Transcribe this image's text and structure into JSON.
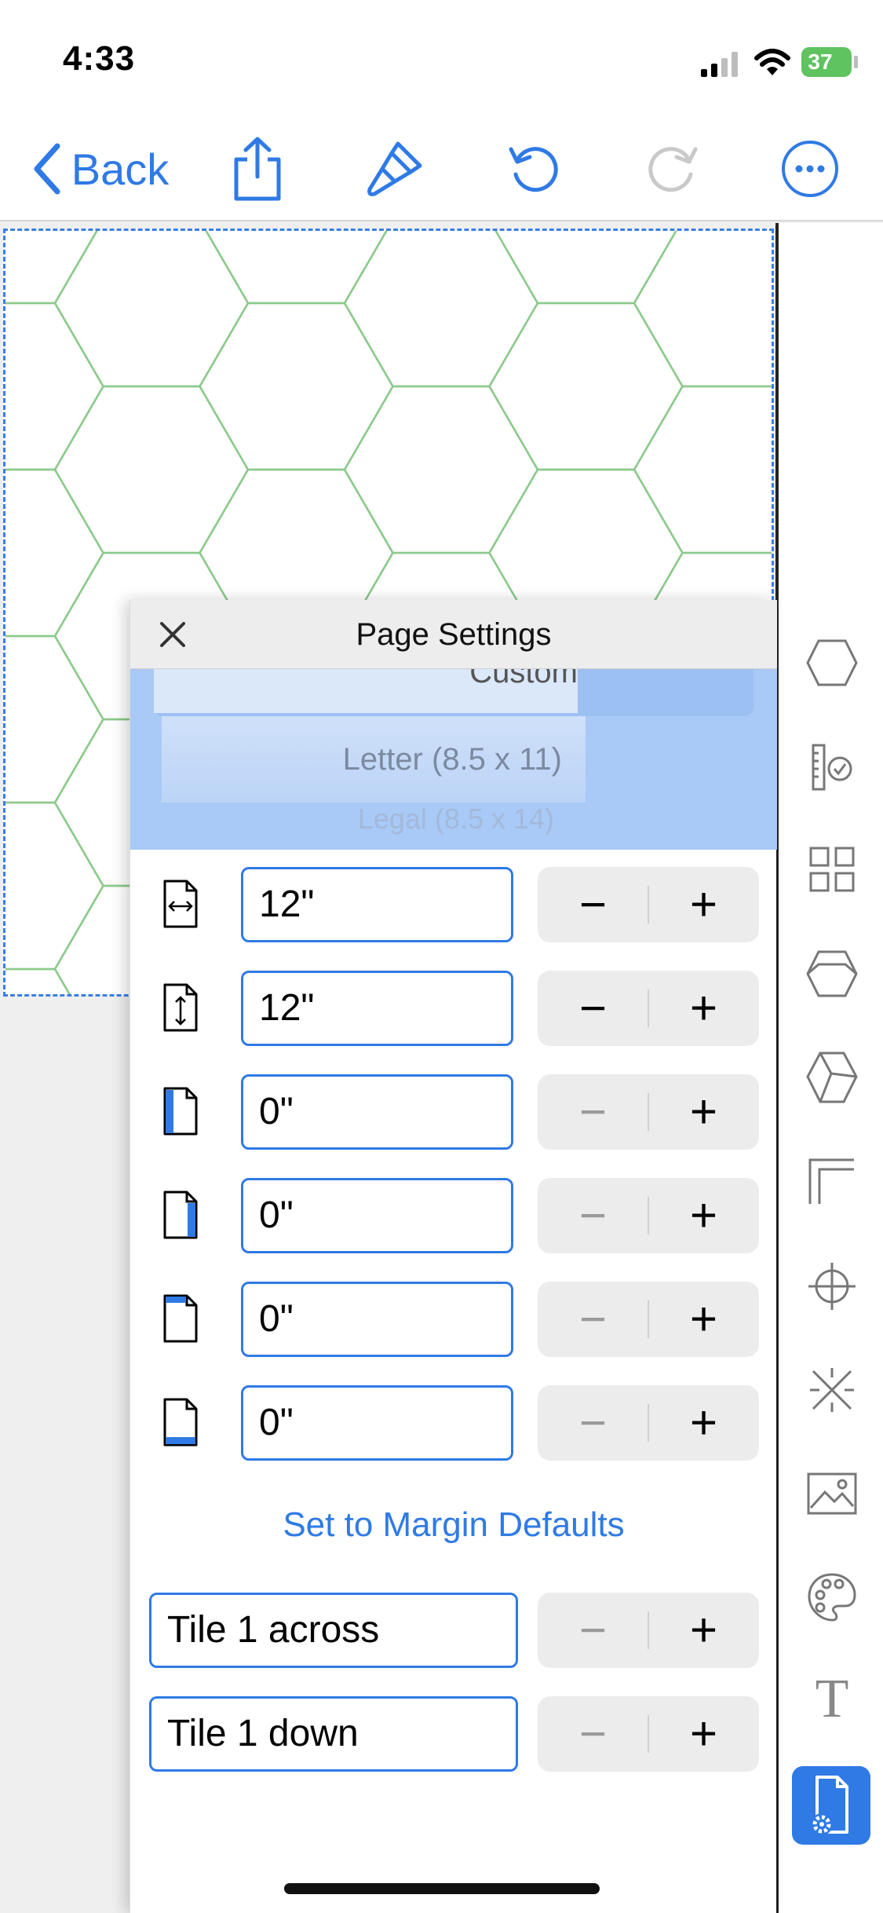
{
  "status_bar": {
    "time": "4:33",
    "battery": "37"
  },
  "toolbar": {
    "back_label": "Back",
    "icons": [
      "share-icon",
      "paintbrush-icon",
      "undo-icon",
      "redo-icon",
      "more-icon"
    ]
  },
  "panel": {
    "title": "Page Settings",
    "picker": {
      "custom": "Custom",
      "letter": "Letter (8.5 x 11)",
      "legal": "Legal (8.5 x 14)"
    },
    "rows": [
      {
        "name": "width",
        "value": "12\"",
        "minus_enabled": true
      },
      {
        "name": "height",
        "value": "12\"",
        "minus_enabled": true
      },
      {
        "name": "margin-left",
        "value": "0\"",
        "minus_enabled": false
      },
      {
        "name": "margin-right",
        "value": "0\"",
        "minus_enabled": false
      },
      {
        "name": "margin-top",
        "value": "0\"",
        "minus_enabled": false
      },
      {
        "name": "margin-bottom",
        "value": "0\"",
        "minus_enabled": false
      }
    ],
    "minus_symbol": "−",
    "plus_symbol": "+",
    "margin_defaults_label": "Set to Margin Defaults",
    "tile_across": "Tile 1 across",
    "tile_down": "Tile 1 down"
  },
  "rail": {
    "icons": [
      "hexagon-icon",
      "ruler-check-icon",
      "grid-icon",
      "hex-prism-icon",
      "cube-icon",
      "corner-icon",
      "crosshair-icon",
      "scissors-icon",
      "image-icon",
      "palette-icon",
      "text-icon",
      "page-settings-icon"
    ],
    "text_glyph": "T",
    "selected": "page-settings-icon"
  },
  "colors": {
    "accent": "#2f7ae5",
    "grid_line": "#8cc98c",
    "picker_bg": "#a9c9f6"
  }
}
